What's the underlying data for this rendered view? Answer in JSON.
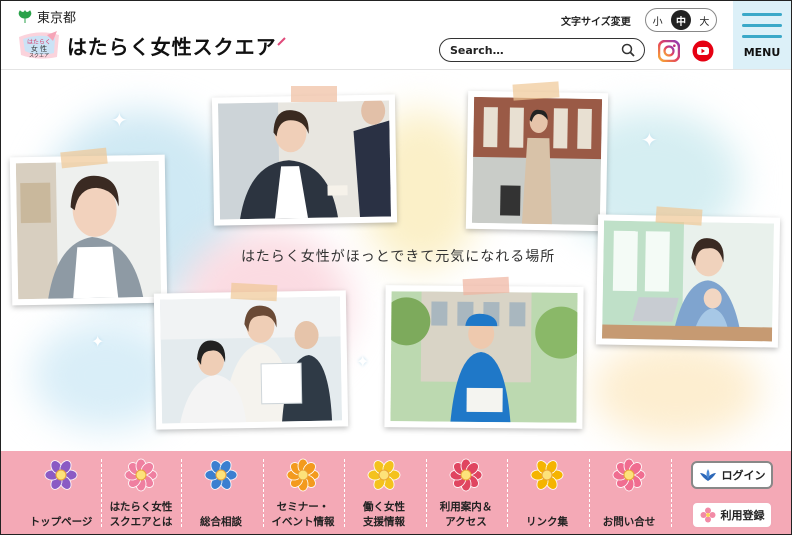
{
  "header": {
    "gov_name": "東京都",
    "site_title": "はたらく女性スクエア",
    "logo_mark_text": "はたらく女性スクエア",
    "font_size_label": "文字サイズ変更",
    "font_sizes": [
      "小",
      "中",
      "大"
    ],
    "font_size_selected": "中",
    "search_placeholder": "Search…",
    "menu_label": "MENU"
  },
  "hero": {
    "tagline": "はたらく女性がほっとできて元気になれる場所"
  },
  "nav": {
    "items": [
      {
        "label": "トップページ",
        "icon": "purple-flower-icon",
        "color": "#8b5bc4"
      },
      {
        "label": "はたらく女性\nスクエアとは",
        "icon": "pink-flower-icon",
        "color": "#ef7fa0"
      },
      {
        "label": "総合相談",
        "icon": "blue-flower-icon",
        "color": "#3b7fd0"
      },
      {
        "label": "セミナー・\nイベント情報",
        "icon": "orange-flower-icon",
        "color": "#f39a1e"
      },
      {
        "label": "働く女性\n支援情報",
        "icon": "yellow-flower-icon",
        "color": "#f4c21d"
      },
      {
        "label": "利用案内＆\nアクセス",
        "icon": "red-flower-icon",
        "color": "#e04560"
      },
      {
        "label": "リンク集",
        "icon": "sunflower-icon",
        "color": "#f5b400"
      },
      {
        "label": "お問い合せ",
        "icon": "rose-flower-icon",
        "color": "#f06d90"
      }
    ],
    "login_label": "ログイン",
    "register_label": "利用登録"
  },
  "colors": {
    "nav_bg": "#f4a9b6",
    "menu_bg": "#dcf0f8",
    "menu_accent": "#3aa8c8"
  }
}
